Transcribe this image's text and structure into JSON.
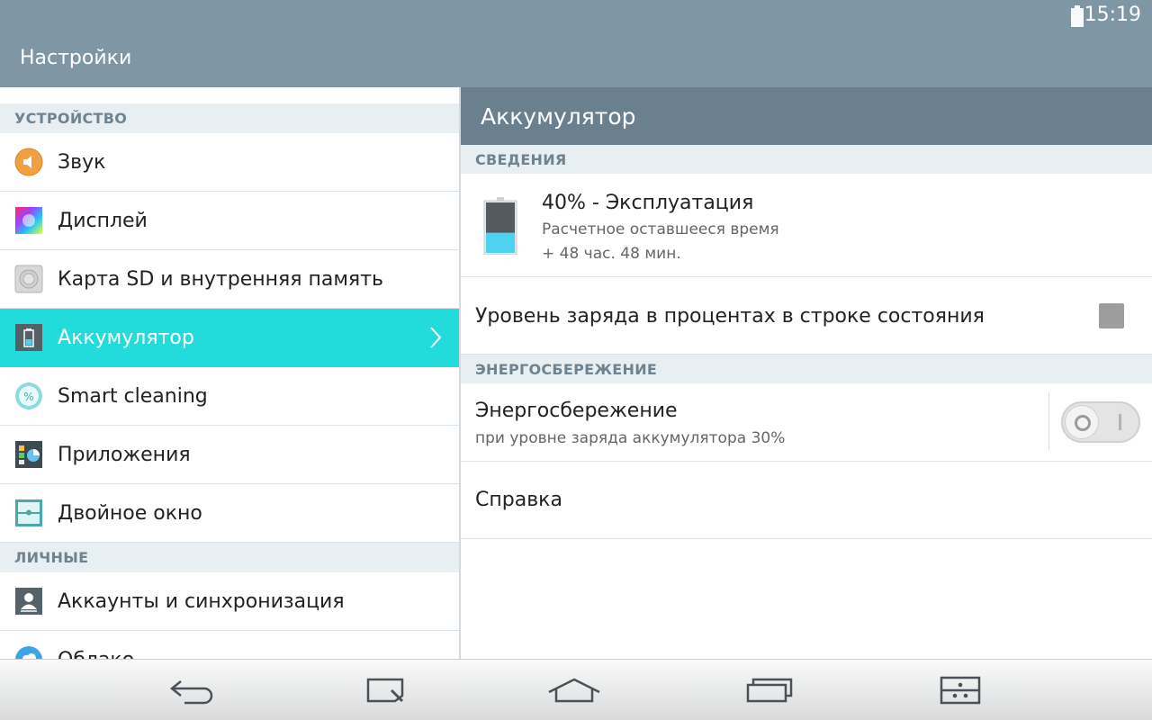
{
  "status_bar": {
    "time": "15:19",
    "battery_icon": "battery-icon"
  },
  "app_bar": {
    "title": "Настройки"
  },
  "sidebar": {
    "sections": [
      {
        "label": "УСТРОЙСТВО"
      },
      {
        "label": "ЛИЧНЫЕ"
      }
    ],
    "items": [
      {
        "label": "Звук",
        "icon": "sound-icon"
      },
      {
        "label": "Дисплей",
        "icon": "display-icon"
      },
      {
        "label": "Карта SD и внутренняя память",
        "icon": "storage-icon"
      },
      {
        "label": "Аккумулятор",
        "icon": "battery-icon",
        "selected": true
      },
      {
        "label": "Smart cleaning",
        "icon": "smart-cleaning-icon"
      },
      {
        "label": "Приложения",
        "icon": "apps-icon"
      },
      {
        "label": "Двойное окно",
        "icon": "dual-window-icon"
      },
      {
        "label": "Аккаунты и синхронизация",
        "icon": "accounts-icon"
      },
      {
        "label": "Облако",
        "icon": "cloud-icon"
      }
    ]
  },
  "detail": {
    "title": "Аккумулятор",
    "info_section": "СВЕДЕНИЯ",
    "battery": {
      "level": 0.4,
      "title": "40% - Эксплуатация",
      "remaining_label": "Расчетное оставшееся время",
      "remaining_value": "+ 48 час. 48 мин."
    },
    "percent_in_status_bar": {
      "label": "Уровень заряда в процентах в строке состояния",
      "checked": false
    },
    "power_saving_section": "ЭНЕРГОСБЕРЕЖЕНИЕ",
    "power_saving": {
      "title": "Энергосбережение",
      "subtitle": "при уровне заряда аккумулятора 30%",
      "enabled": false
    },
    "help": {
      "label": "Справка"
    }
  },
  "nav_bar": {
    "buttons": [
      "back-icon",
      "notes-icon",
      "home-icon",
      "recent-apps-icon",
      "dual-window-icon"
    ]
  },
  "colors": {
    "top_bar": "#7f97a5",
    "detail_title_bar": "#6b808e",
    "selected_item": "#22dbda",
    "battery_fill": "#4ed2f0"
  }
}
